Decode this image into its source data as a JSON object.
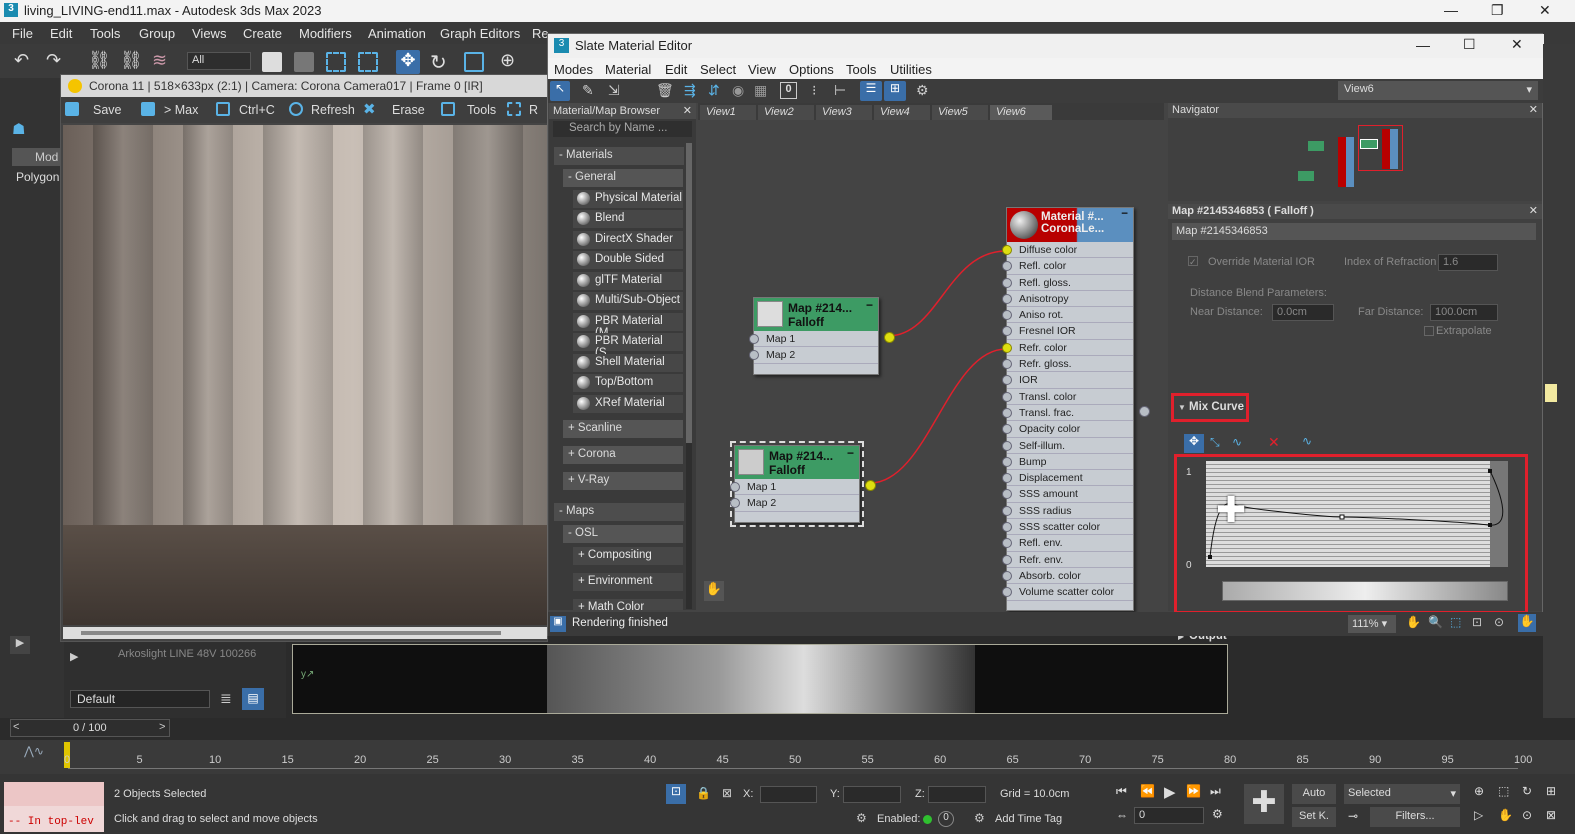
{
  "app": {
    "title": "living_LIVING-end11.max - Autodesk 3ds Max 2023"
  },
  "menu": [
    "File",
    "Edit",
    "Tools",
    "Group",
    "Views",
    "Create",
    "Modifiers",
    "Animation",
    "Graph Editors",
    "Re"
  ],
  "toolbar": {
    "selection_filter": "All"
  },
  "left_panel": {
    "mode_label": "Mod",
    "polygon_label": "Polygon",
    "layer_default": "Default",
    "layer_item": "Arkoslight LINE 48V 100266",
    "time_counter": "0 / 100"
  },
  "frame_buffer": {
    "title": "Corona 11 | 518×633px (2:1) | Camera: Corona Camera017 | Frame 0 [IR]",
    "save": "Save",
    "to_max": "> Max",
    "ctrl_c": "Ctrl+C",
    "refresh": "Refresh",
    "erase": "Erase",
    "tools": "Tools",
    "r": "R"
  },
  "sme": {
    "title": "Slate Material Editor",
    "menu": [
      "Modes",
      "Material",
      "Edit",
      "Select",
      "View",
      "Options",
      "Tools",
      "Utilities"
    ],
    "view_dropdown": "View6",
    "browser": {
      "header": "Material/Map Browser",
      "search_placeholder": "Search by Name ...",
      "materials": "- Materials",
      "general": "- General",
      "general_items": [
        "Physical Material",
        "Blend",
        "DirectX Shader",
        "Double Sided",
        "glTF Material",
        "Multi/Sub-Object",
        "PBR Material (M...",
        "PBR Material (S...",
        "Shell Material",
        "Top/Bottom",
        "XRef Material"
      ],
      "scanline": "+ Scanline",
      "corona": "+ Corona",
      "vray": "+ V-Ray",
      "maps": "- Maps",
      "osl": "- OSL",
      "compositing": "+ Compositing",
      "environment": "+ Environment",
      "math_color": "+ Math Color"
    },
    "view_tabs": [
      "View1",
      "View2",
      "View3",
      "View4",
      "View5",
      "View6"
    ],
    "node_falloff1": {
      "title1": "Map  #214...",
      "title2": "Falloff",
      "slots": [
        "Map 1",
        "Map 2"
      ]
    },
    "node_falloff2": {
      "title1": "Map  #214...",
      "title2": "Falloff",
      "slots": [
        "Map 1",
        "Map 2"
      ]
    },
    "node_material": {
      "title1": "Material  #...",
      "title2": "CoronaLe...",
      "slots": [
        "Diffuse color",
        "Refl. color",
        "Refl. gloss.",
        "Anisotropy",
        "Aniso rot.",
        "Fresnel IOR",
        "Refr. color",
        "Refr. gloss.",
        "IOR",
        "Transl. color",
        "Transl. frac.",
        "Opacity color",
        "Self-illum.",
        "Bump",
        "Displacement",
        "SSS amount",
        "SSS radius",
        "SSS scatter color",
        "Refl. env.",
        "Refr. env.",
        "Absorb. color",
        "Volume scatter color"
      ]
    },
    "navigator": "Navigator",
    "props": {
      "header": "Map #2145346853  ( Falloff )",
      "name_field": "Map #2145346853",
      "override_ior": "Override Material IOR",
      "ior_label": "Index of Refraction",
      "ior_value": "1.6",
      "dist_blend": "Distance Blend Parameters:",
      "near_label": "Near Distance:",
      "near_value": "0.0cm",
      "far_label": "Far Distance:",
      "far_value": "100.0cm",
      "extrapolate": "Extrapolate",
      "mix_curve": "Mix Curve",
      "curve_y1": "1",
      "curve_y0": "0",
      "output": "Output"
    },
    "status": "Rendering finished",
    "zoom": "111%"
  },
  "timeline": {
    "ticks": [
      "0",
      "5",
      "10",
      "15",
      "20",
      "25",
      "30",
      "35",
      "40",
      "45",
      "50",
      "55",
      "60",
      "65",
      "70",
      "75",
      "80",
      "85",
      "90",
      "95",
      "100"
    ]
  },
  "status_bar": {
    "selected": "2 Objects Selected",
    "hint": "Click and drag to select and move objects",
    "script": "-- In top-lev",
    "x": "X:",
    "y": "Y:",
    "z": "Z:",
    "grid": "Grid = 10.0cm",
    "enabled": "Enabled:",
    "enabled_val": "0",
    "add_time_tag": "Add Time Tag",
    "auto": "Auto",
    "set_k": "Set K.",
    "selected_dd": "Selected",
    "filters": "Filters...",
    "frame": "0"
  }
}
